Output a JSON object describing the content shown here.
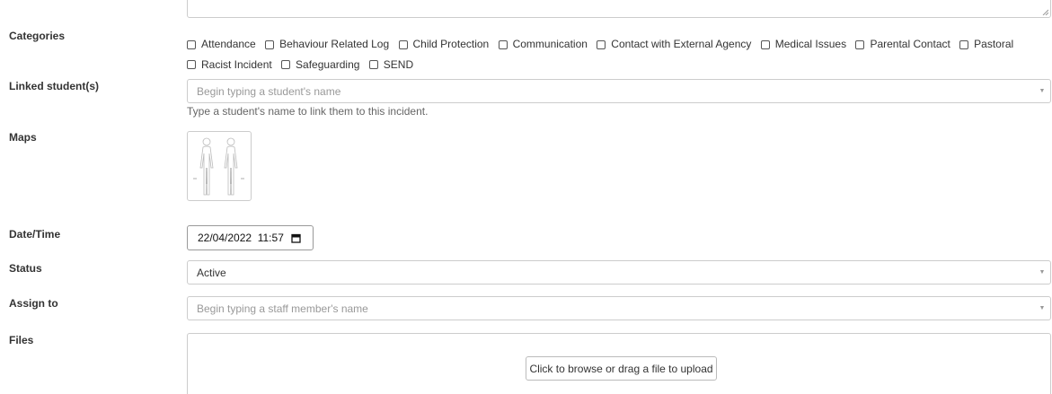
{
  "form": {
    "categories": {
      "label": "Categories",
      "options": [
        "Attendance",
        "Behaviour Related Log",
        "Child Protection",
        "Communication",
        "Contact with External Agency",
        "Medical Issues",
        "Parental Contact",
        "Pastoral",
        "Racist Incident",
        "Safeguarding",
        "SEND"
      ]
    },
    "linked_students": {
      "label": "Linked student(s)",
      "placeholder": "Begin typing a student's name",
      "help": "Type a student's name to link them to this incident."
    },
    "maps": {
      "label": "Maps",
      "thumbnail_icon": "body-map-icon"
    },
    "datetime": {
      "label": "Date/Time",
      "value": "22/04/2022  11:57",
      "icon": "calendar-icon"
    },
    "status": {
      "label": "Status",
      "value": "Active"
    },
    "assign_to": {
      "label": "Assign to",
      "placeholder": "Begin typing a staff member's name"
    },
    "files": {
      "label": "Files",
      "upload_label": "Click to browse or drag a file to upload"
    }
  },
  "colors": {
    "border": "#cccccc",
    "placeholder": "#999999",
    "label": "#333333"
  }
}
